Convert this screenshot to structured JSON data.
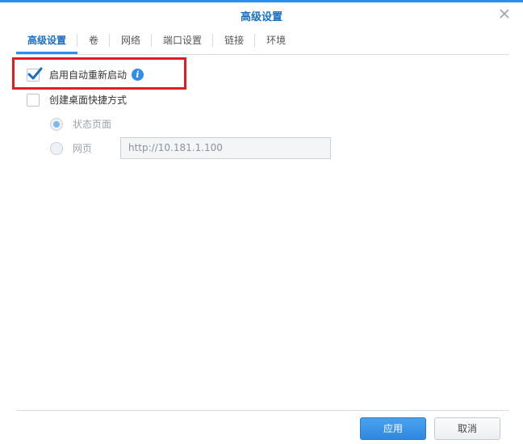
{
  "dialog": {
    "title": "高级设置"
  },
  "tabs": [
    {
      "label": "高级设置",
      "active": true
    },
    {
      "label": "卷",
      "active": false
    },
    {
      "label": "网络",
      "active": false
    },
    {
      "label": "端口设置",
      "active": false
    },
    {
      "label": "链接",
      "active": false
    },
    {
      "label": "环境",
      "active": false
    }
  ],
  "options": {
    "auto_restart": {
      "label": "启用自动重新启动",
      "checked": true
    },
    "desktop_shortcut": {
      "label": "创建桌面快捷方式",
      "checked": false
    },
    "status_page": {
      "label": "状态页面",
      "selected": true
    },
    "webpage": {
      "label": "网页",
      "selected": false
    },
    "webpage_url": {
      "value": "http://10.181.1.100"
    }
  },
  "footer": {
    "apply_label": "应用",
    "cancel_label": "取消"
  },
  "colors": {
    "accent": "#2f8ee8",
    "highlight": "#e21b24"
  }
}
